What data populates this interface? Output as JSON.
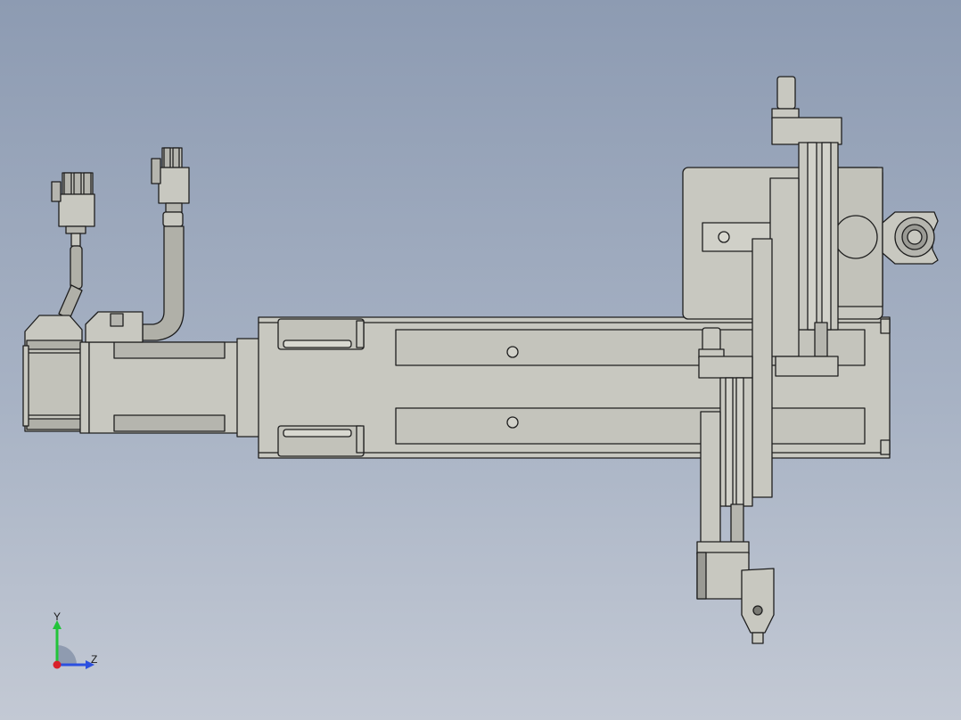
{
  "viewport": {
    "background_top": "#8d9bb2",
    "background_bottom": "#c3c9d4"
  },
  "model": {
    "part_fill": "#c8c8c0",
    "part_fill_dark": "#9a9a94",
    "edge_color": "#1e1e1e"
  },
  "triad": {
    "y_label": "Y",
    "z_label": "Z",
    "y_color": "#22c43a",
    "z_color": "#2b4fe0",
    "x_color": "#d8202a"
  }
}
